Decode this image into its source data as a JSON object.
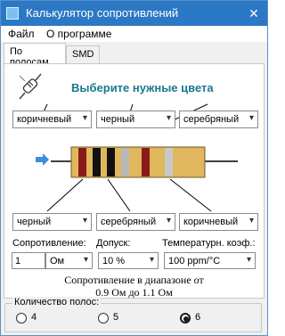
{
  "window": {
    "title": "Калькулятор сопротивлений",
    "close_glyph": "✕"
  },
  "menu": [
    "Файл",
    "О программе"
  ],
  "tabs": [
    {
      "label": "По полосам",
      "active": true
    },
    {
      "label": "SMD",
      "active": false
    }
  ],
  "headline": "Выберите нужные цвета",
  "top_bands": [
    "коричневый",
    "черный",
    "серебряный"
  ],
  "bottom_bands": [
    "черный",
    "серебряный",
    "коричневый"
  ],
  "params": {
    "resistance_label": "Сопротивление:",
    "resistance_value": "1",
    "resistance_unit": "Ом",
    "tolerance_label": "Допуск:",
    "tolerance_value": "10 %",
    "tempco_label": "Температурн. коэф.:",
    "tempco_value": "100 ppm/°C"
  },
  "range": {
    "line1": "Сопротивление в диапазоне от",
    "line2": "0.9 Ом до 1.1 Ом"
  },
  "band_count": {
    "legend": "Количество полос:",
    "options": [
      "4",
      "5",
      "6"
    ],
    "selected": "6"
  },
  "band_colors": [
    "#8b1a1a",
    "#111111",
    "#111111",
    "#b8b8b8",
    "#8b1a1a",
    "#c8c8c8"
  ],
  "colors": {
    "accent": "#1a7890",
    "titlebar": "#2b78c4",
    "resistor_body": "#e0b75c"
  }
}
